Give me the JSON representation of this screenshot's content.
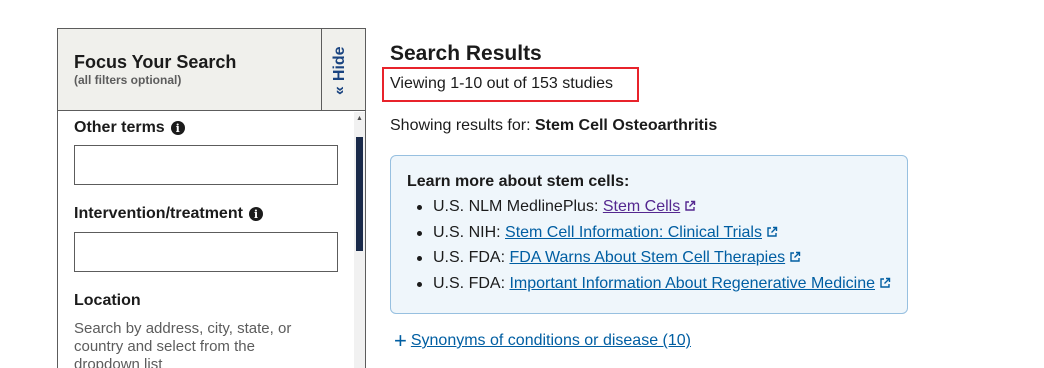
{
  "filter_panel": {
    "title": "Focus Your Search",
    "subtitle": "(all filters optional)",
    "hide_label": "Hide",
    "hide_icon": "double-chevron-left-icon",
    "other_terms": {
      "label": "Other terms",
      "value": "",
      "placeholder": ""
    },
    "intervention": {
      "label": "Intervention/treatment",
      "value": "",
      "placeholder": ""
    },
    "location": {
      "label": "Location",
      "hint": "Search by address, city, state, or country and select from the dropdown list"
    }
  },
  "results": {
    "title": "Search Results",
    "viewing_text": "Viewing 1-10 out of 153 studies",
    "showing_prefix": "Showing results for: ",
    "query": "Stem Cell Osteoarthritis"
  },
  "info_box": {
    "heading": "Learn more about stem cells:",
    "items": [
      {
        "prefix": "U.S. NLM MedlinePlus: ",
        "link": "Stem Cells"
      },
      {
        "prefix": "U.S. NIH: ",
        "link": "Stem Cell Information: Clinical Trials"
      },
      {
        "prefix": "U.S. FDA: ",
        "link": "FDA Warns About Stem Cell Therapies"
      },
      {
        "prefix": "U.S. FDA: ",
        "link": "Important Information About Regenerative Medicine"
      }
    ]
  },
  "synonyms": {
    "label": "Synonyms of conditions or disease (10)",
    "icon": "plus-icon"
  },
  "colors": {
    "link": "#005ea2",
    "visited_link": "#54278f",
    "highlight_border": "#e8232b",
    "info_box_bg": "#eff6fb",
    "panel_header_bg": "#f0f0ec"
  }
}
